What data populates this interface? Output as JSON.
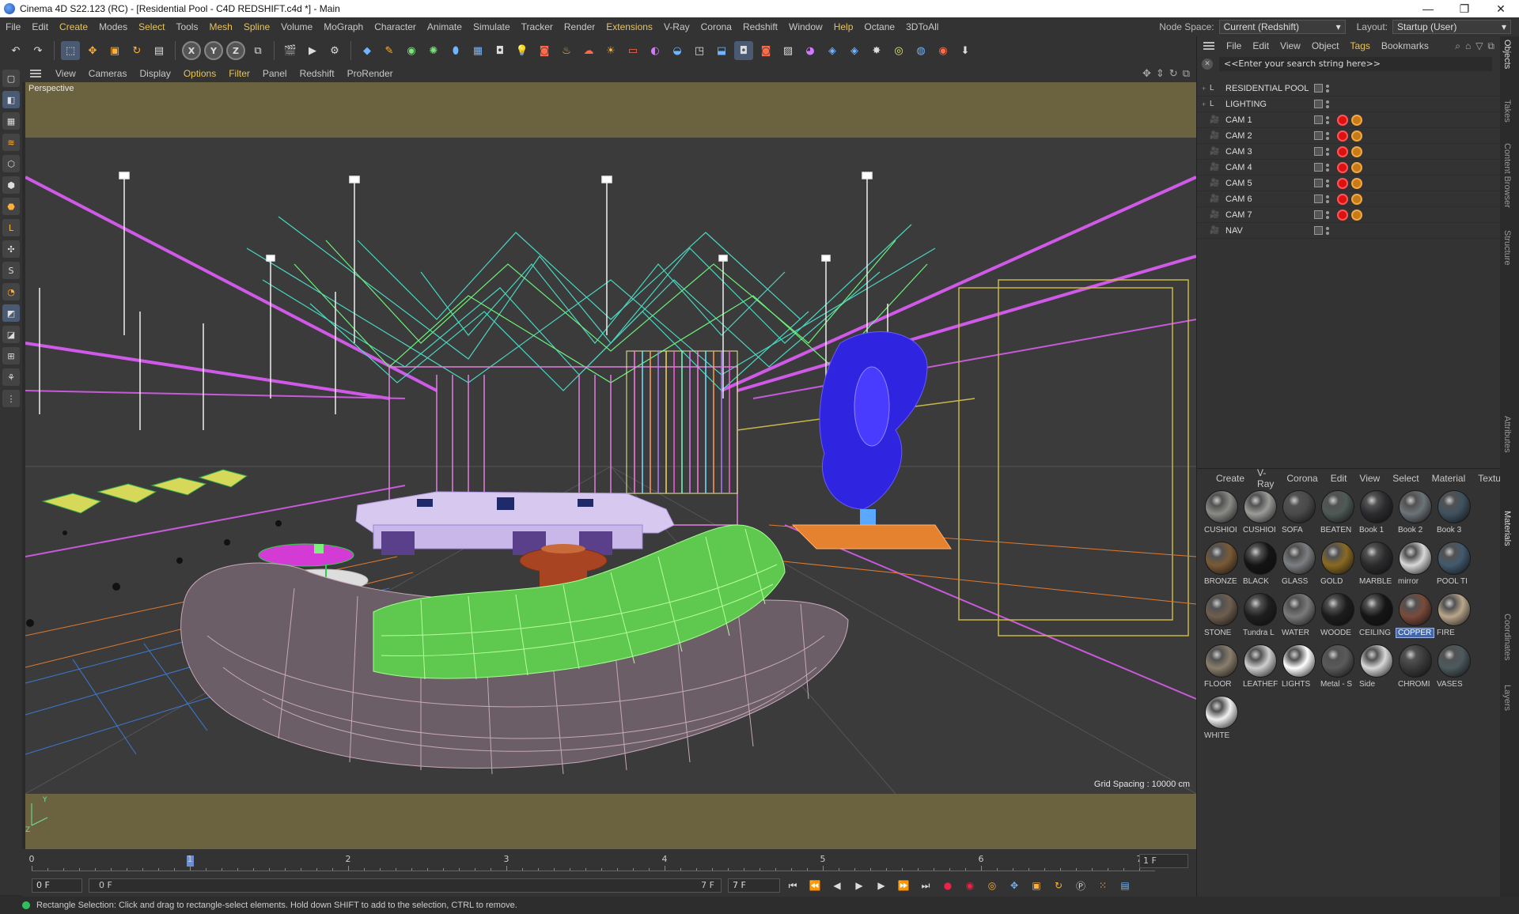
{
  "window": {
    "title": "Cinema 4D S22.123 (RC) - [Residential Pool - C4D REDSHIFT.c4d *] - Main",
    "controls": [
      "—",
      "❐",
      "✕"
    ]
  },
  "menubar": {
    "items": [
      "File",
      "Edit",
      "Create",
      "Modes",
      "Select",
      "Tools",
      "Mesh",
      "Spline",
      "Volume",
      "MoGraph",
      "Character",
      "Animate",
      "Simulate",
      "Tracker",
      "Render",
      "Extensions",
      "V-Ray",
      "Corona",
      "Redshift",
      "Window",
      "Help",
      "Octane",
      "3DToAll"
    ],
    "node_space_label": "Node Space:",
    "node_space_value": "Current (Redshift)",
    "layout_label": "Layout:",
    "layout_value": "Startup (User)"
  },
  "viewport": {
    "menu": [
      "View",
      "Cameras",
      "Display",
      "Options",
      "Filter",
      "Panel",
      "Redshift",
      "ProRender"
    ],
    "label": "Perspective",
    "grid_spacing": "Grid Spacing : 10000 cm",
    "axis_y": "Y",
    "axis_z": "Z"
  },
  "timeline": {
    "ticks": [
      "0",
      "1",
      "2",
      "3",
      "4",
      "5",
      "6",
      "7"
    ],
    "current_frame": "1 F",
    "playhead_frame": 1
  },
  "transport": {
    "start_field": "0 F",
    "range_start": "0 F",
    "range_end": "7 F",
    "end_field": "7 F"
  },
  "status": {
    "message": "Rectangle Selection: Click and drag to rectangle-select elements. Hold down SHIFT to add to the selection, CTRL to remove."
  },
  "object_manager": {
    "menu": [
      "File",
      "Edit",
      "View",
      "Object",
      "Tags",
      "Bookmarks"
    ],
    "search_placeholder": "<<Enter your search string here>>",
    "objects": [
      {
        "name": "RESIDENTIAL POOL",
        "icon": "null-object-icon",
        "tags": []
      },
      {
        "name": "LIGHTING",
        "icon": "null-object-icon",
        "tags": []
      },
      {
        "name": "CAM 1",
        "icon": "camera-icon",
        "tags": [
          "redshift-tag",
          "protection-tag"
        ]
      },
      {
        "name": "CAM 2",
        "icon": "camera-icon",
        "tags": [
          "redshift-tag",
          "protection-tag"
        ]
      },
      {
        "name": "CAM 3",
        "icon": "camera-icon",
        "tags": [
          "redshift-tag",
          "protection-tag"
        ]
      },
      {
        "name": "CAM 4",
        "icon": "camera-icon",
        "tags": [
          "redshift-tag",
          "protection-tag"
        ]
      },
      {
        "name": "CAM 5",
        "icon": "camera-icon",
        "tags": [
          "redshift-tag",
          "protection-tag"
        ]
      },
      {
        "name": "CAM 6",
        "icon": "camera-icon",
        "tags": [
          "redshift-tag",
          "protection-tag"
        ]
      },
      {
        "name": "CAM 7",
        "icon": "camera-icon",
        "tags": [
          "redshift-tag",
          "protection-tag"
        ]
      },
      {
        "name": "NAV",
        "icon": "camera-icon",
        "tags": []
      }
    ]
  },
  "material_manager": {
    "menu": [
      "Create",
      "V-Ray",
      "Corona",
      "Edit",
      "View",
      "Select",
      "Material",
      "Textu"
    ],
    "materials": [
      {
        "name": "CUSHIOI",
        "color": "#8a8a86"
      },
      {
        "name": "CUSHIOI",
        "color": "#9b9b98"
      },
      {
        "name": "SOFA",
        "color": "#4a4a4a"
      },
      {
        "name": "BEATEN",
        "color": "#4f5a55"
      },
      {
        "name": "Book 1",
        "color": "#2c2c30"
      },
      {
        "name": "Book 2",
        "color": "#6c7478"
      },
      {
        "name": "Book 3",
        "color": "#3f5260"
      },
      {
        "name": "BRONZE",
        "color": "#7a5a35"
      },
      {
        "name": "BLACK",
        "color": "#141414"
      },
      {
        "name": "GLASS",
        "color": "#7c7f82"
      },
      {
        "name": "GOLD",
        "color": "#8a6a22"
      },
      {
        "name": "MARBLE",
        "color": "#2b2b2d"
      },
      {
        "name": "mirror",
        "color": "#d8d8d8"
      },
      {
        "name": "POOL TI",
        "color": "#425a6e"
      },
      {
        "name": "STONE",
        "color": "#6e5e4e"
      },
      {
        "name": "Tundra L",
        "color": "#1e1e1e"
      },
      {
        "name": "WATER",
        "color": "#7a7a7a"
      },
      {
        "name": "WOODE",
        "color": "#1c1c1c"
      },
      {
        "name": "CEILING",
        "color": "#151515"
      },
      {
        "name": "COPPER",
        "color": "#7a4a3a"
      },
      {
        "name": "FIRE",
        "color": "#b9a68c"
      },
      {
        "name": "FLOOR",
        "color": "#8b7e6c"
      },
      {
        "name": "LEATHEF",
        "color": "#cfcfcf"
      },
      {
        "name": "LIGHTS",
        "color": "#ffffff"
      },
      {
        "name": "Metal - S",
        "color": "#5a5a5a"
      },
      {
        "name": "Side",
        "color": "#d8d8d8"
      },
      {
        "name": "CHROMI",
        "color": "#3a3a3a"
      },
      {
        "name": "VASES",
        "color": "#4c5a5e"
      },
      {
        "name": "WHITE",
        "color": "#f0f0f0"
      }
    ],
    "selected": "COPPER"
  },
  "side_tabs": [
    "Objects",
    "Takes",
    "Content Browser",
    "Structure",
    "Attributes",
    "Materials",
    "Coordinates",
    "Layers"
  ]
}
